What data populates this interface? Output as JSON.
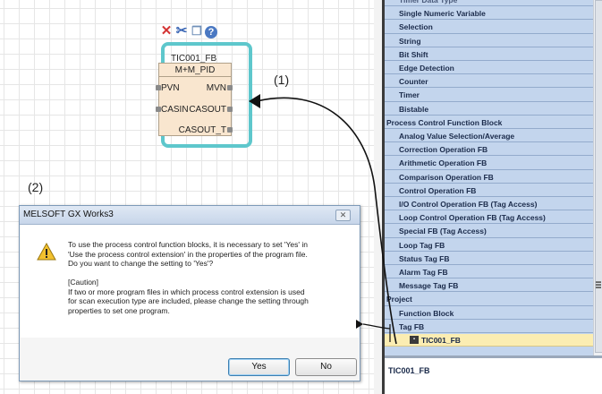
{
  "fb_toolbar": {
    "icons": [
      "delete-icon",
      "cut-icon",
      "copy-icon",
      "help-icon"
    ]
  },
  "function_block": {
    "instance_name": "TIC001_FB",
    "type_name": "M+M_PID",
    "inputs": [
      "PVN",
      "CASIN"
    ],
    "outputs": [
      "MVN",
      "CASOUT",
      "CASOUT_T"
    ]
  },
  "annotations": {
    "one": "(1)",
    "two": "(2)"
  },
  "dialog": {
    "title": "MELSOFT GX Works3",
    "close_label": "✕",
    "message": "To use the process control function blocks, it is necessary to set 'Yes' in\n'Use the process control extension' in the properties of the program file.\nDo you want to change the setting to 'Yes'?\n\n[Caution]\nIf two or more program files in which process control extension is used\nfor scan execution type are included, please change the setting through\nproperties to set one program.",
    "yes_label": "Yes",
    "no_label": "No"
  },
  "tree": {
    "items": [
      {
        "label": "Timer Data Type",
        "indent": 1
      },
      {
        "label": "Single Numeric Variable",
        "indent": 1
      },
      {
        "label": "Selection",
        "indent": 1
      },
      {
        "label": "String",
        "indent": 1
      },
      {
        "label": "Bit Shift",
        "indent": 1
      },
      {
        "label": "Edge Detection",
        "indent": 1
      },
      {
        "label": "Counter",
        "indent": 1
      },
      {
        "label": "Timer",
        "indent": 1
      },
      {
        "label": "Bistable",
        "indent": 1
      },
      {
        "label": "Process Control Function Block",
        "indent": 0
      },
      {
        "label": "Analog Value Selection/Average",
        "indent": 1
      },
      {
        "label": "Correction Operation FB",
        "indent": 1
      },
      {
        "label": "Arithmetic Operation FB",
        "indent": 1
      },
      {
        "label": "Comparison Operation FB",
        "indent": 1
      },
      {
        "label": "Control Operation FB",
        "indent": 1
      },
      {
        "label": "I/O Control Operation FB (Tag Access)",
        "indent": 1
      },
      {
        "label": "Loop Control Operation FB (Tag Access)",
        "indent": 1
      },
      {
        "label": "Special FB (Tag Access)",
        "indent": 1
      },
      {
        "label": "Loop Tag FB",
        "indent": 1
      },
      {
        "label": "Status Tag FB",
        "indent": 1
      },
      {
        "label": "Alarm Tag FB",
        "indent": 1
      },
      {
        "label": "Message Tag FB",
        "indent": 1
      },
      {
        "label": "Project",
        "indent": 0
      },
      {
        "label": "Function Block",
        "indent": 1
      },
      {
        "label": "Tag FB",
        "indent": 1
      },
      {
        "label": "TIC001_FB",
        "indent": 2,
        "selected": true
      }
    ]
  },
  "properties": {
    "title": "TIC001_FB"
  }
}
